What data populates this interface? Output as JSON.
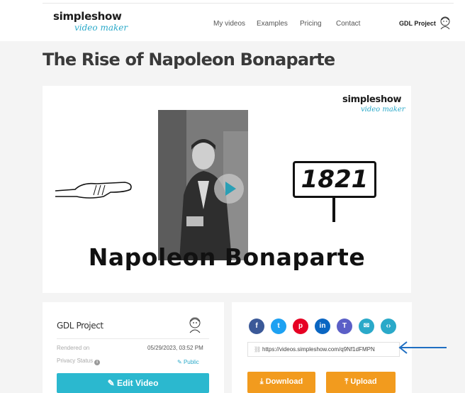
{
  "header": {
    "logo_main": "simpleshow",
    "logo_sub": "video maker",
    "nav": [
      "My videos",
      "Examples",
      "Pricing",
      "Contact"
    ],
    "project": "GDL Project"
  },
  "page": {
    "title": "The Rise of Napoleon Bonaparte"
  },
  "video": {
    "logo_main": "simpleshow",
    "logo_sub": "video maker",
    "year": "1821",
    "caption": "Napoleon Bonaparte"
  },
  "info": {
    "project": "GDL Project",
    "rendered_label": "Rendered on",
    "rendered_value": "05/29/2023, 03:52 PM",
    "privacy_label": "Privacy Status",
    "privacy_value": "Public",
    "edit_label": "Edit Video"
  },
  "share": {
    "icons": [
      {
        "name": "facebook-icon",
        "glyph": "f",
        "color": "#3b5998"
      },
      {
        "name": "twitter-icon",
        "glyph": "t",
        "color": "#1da1f2"
      },
      {
        "name": "pinterest-icon",
        "glyph": "p",
        "color": "#e60023"
      },
      {
        "name": "linkedin-icon",
        "glyph": "in",
        "color": "#0a66c2"
      },
      {
        "name": "teams-icon",
        "glyph": "T",
        "color": "#5b5fc7"
      },
      {
        "name": "email-icon",
        "glyph": "✉",
        "color": "#2aa9c9"
      },
      {
        "name": "embed-icon",
        "glyph": "‹›",
        "color": "#2aa9c9"
      }
    ],
    "url": "https://videos.simpleshow.com/q9Nf1dFMPN",
    "download_label": "Download",
    "upload_label": "Upload"
  },
  "colors": {
    "accent": "#2bb8cf",
    "orange": "#f29b1e",
    "arrow": "#1f6fc2"
  }
}
